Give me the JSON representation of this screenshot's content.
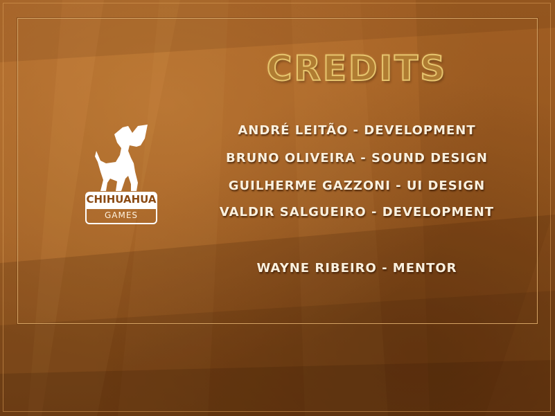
{
  "screen": {
    "title": "CREDITS",
    "colors": {
      "background": "#9a5a20",
      "panel_border": "#d7a566",
      "title_fill": "#b07c32",
      "title_outline": "#e7c56e",
      "credit_text": "#fbf1df"
    }
  },
  "logo": {
    "icon": "chihuahua-dog-icon",
    "brand": "CHIHUAHUA",
    "sub": "GAMES"
  },
  "credits": [
    "ANDRÉ LEITÃO - DEVELOPMENT",
    "BRUNO OLIVEIRA - SOUND DESIGN",
    "GUILHERME GAZZONI - UI DESIGN",
    "VALDIR SALGUEIRO - DEVELOPMENT",
    "WAYNE RIBEIRO - MENTOR"
  ]
}
